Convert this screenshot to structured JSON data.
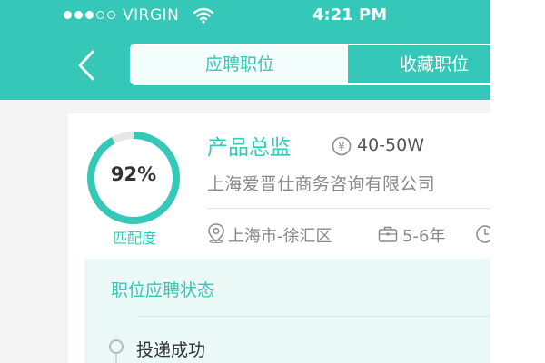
{
  "status_bar": {
    "carrier": "VIRGIN",
    "time": "4:21 PM",
    "signal_dots": [
      true,
      true,
      true,
      false,
      false
    ]
  },
  "nav": {
    "back_icon": "chevron-left-icon",
    "tabs": [
      {
        "label": "应聘职位",
        "active": true
      },
      {
        "label": "收藏职位",
        "active": false
      }
    ]
  },
  "job": {
    "match_percent": 92,
    "match_percent_text": "92%",
    "match_label": "匹配度",
    "title": "产品总监",
    "salary_symbol": "¥",
    "salary": "40-50W",
    "company": "上海爱晋仕商务咨询有限公司",
    "location": "上海市-徐汇区",
    "experience": "5-6年"
  },
  "application_status": {
    "title": "职位应聘状态",
    "steps": [
      {
        "label": "投递成功"
      }
    ]
  },
  "colors": {
    "accent": "#35c7b7",
    "header_bg": "#35c7b7",
    "status_bg": "#eaf9f6"
  }
}
